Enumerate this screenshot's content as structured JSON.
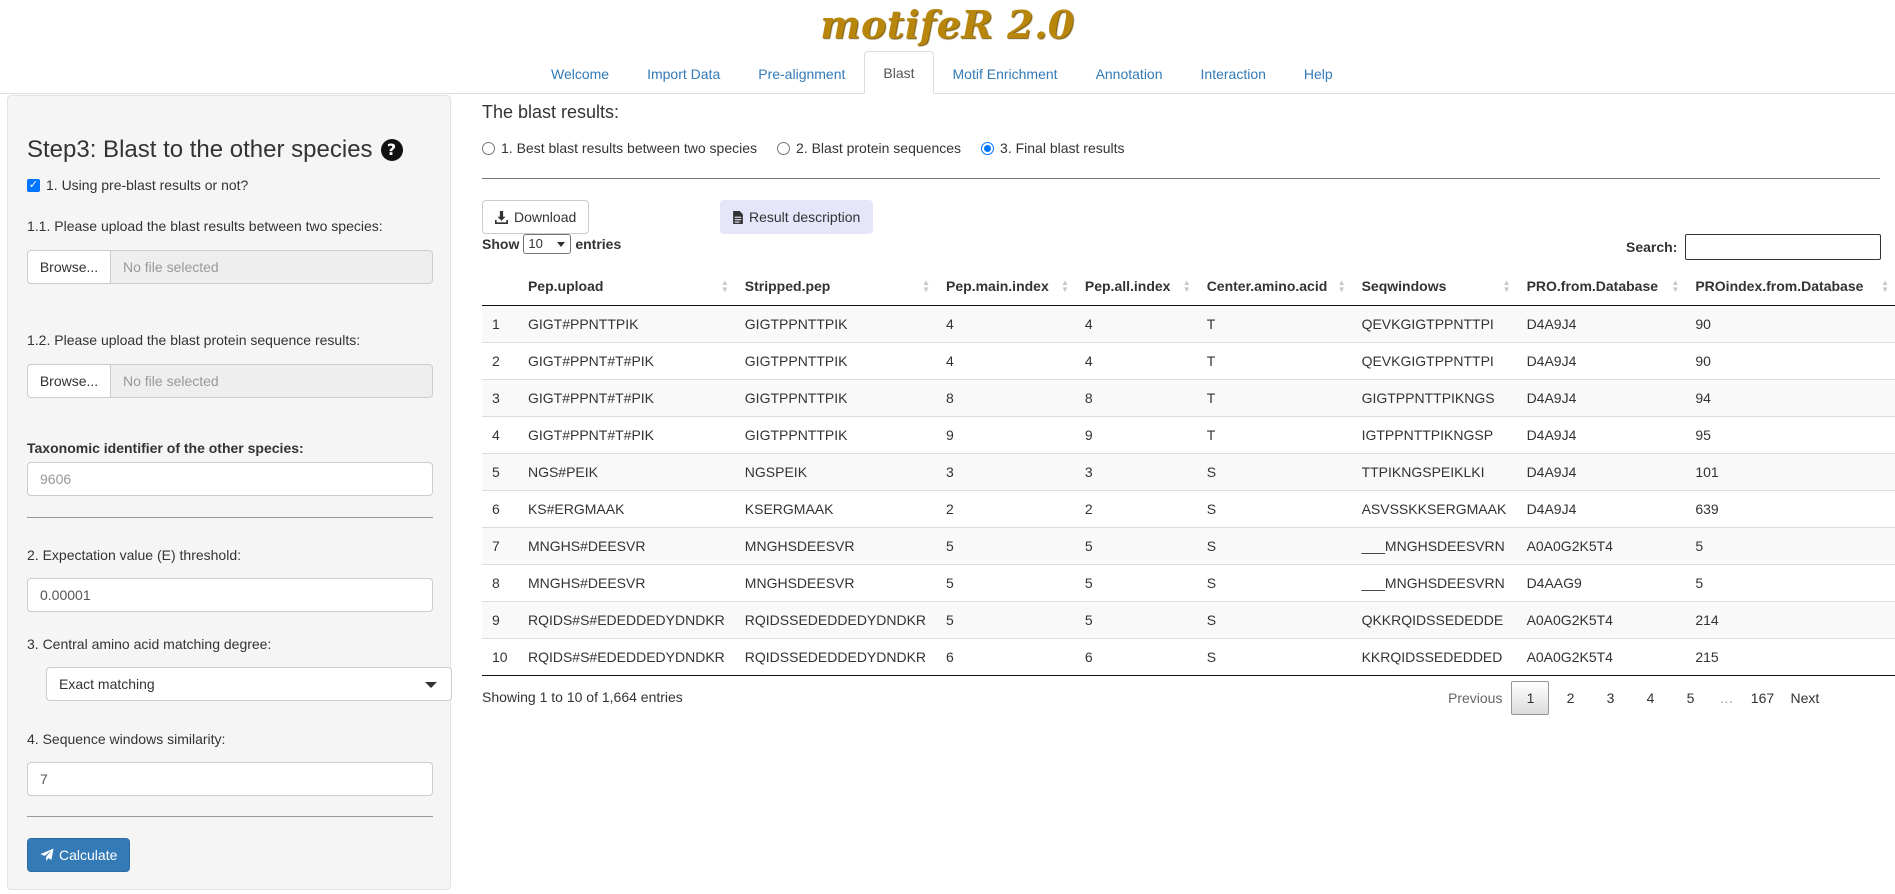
{
  "app": {
    "logo": "motifeR 2.0"
  },
  "nav": {
    "tabs": [
      {
        "label": "Welcome",
        "active": false
      },
      {
        "label": "Import Data",
        "active": false
      },
      {
        "label": "Pre-alignment",
        "active": false
      },
      {
        "label": "Blast",
        "active": true
      },
      {
        "label": "Motif Enrichment",
        "active": false
      },
      {
        "label": "Annotation",
        "active": false
      },
      {
        "label": "Interaction",
        "active": false
      },
      {
        "label": "Help",
        "active": false
      }
    ]
  },
  "sidebar": {
    "title": "Step3: Blast to the other species",
    "help_icon": "question-circle-icon",
    "pre_blast": {
      "label": "1. Using pre-blast results or not?",
      "checked": true
    },
    "upload1": {
      "label": "1.1. Please upload the blast results between two species:",
      "browse": "Browse...",
      "file_text": "No file selected"
    },
    "upload2": {
      "label": "1.2. Please upload the blast protein sequence results:",
      "browse": "Browse...",
      "file_text": "No file selected"
    },
    "taxid": {
      "label": "Taxonomic identifier of the other species:",
      "placeholder": "9606"
    },
    "evalue": {
      "label": "2. Expectation value (E) threshold:",
      "value": "0.00001"
    },
    "central": {
      "label": "3. Central amino acid matching degree:",
      "value": "Exact matching"
    },
    "seqwin": {
      "label": "4. Sequence windows similarity:",
      "value": "7"
    },
    "calculate": {
      "label": "Calculate",
      "icon": "paper-plane-icon"
    }
  },
  "main": {
    "title": "The blast results:",
    "radios": [
      {
        "label": "1. Best blast results between two species",
        "selected": false
      },
      {
        "label": "2. Blast protein sequences",
        "selected": false
      },
      {
        "label": "3. Final blast results",
        "selected": true
      }
    ],
    "download": {
      "label": "Download",
      "icon": "download-icon"
    },
    "desc": {
      "label": "Result description",
      "icon": "file-icon"
    },
    "show": {
      "prefix": "Show",
      "value": "10",
      "suffix": "entries"
    },
    "search": {
      "label": "Search:"
    },
    "table": {
      "headers": [
        "",
        "Pep.upload",
        "Stripped.pep",
        "Pep.main.index",
        "Pep.all.index",
        "Center.amino.acid",
        "Seqwindows",
        "PRO.from.Database",
        "PROindex.from.Database"
      ],
      "rows": [
        [
          "1",
          "GIGT#PPNTTPIK",
          "GIGTPPNTTPIK",
          "4",
          "4",
          "T",
          "QEVKGIGTPPNTTPI",
          "D4A9J4",
          "90"
        ],
        [
          "2",
          "GIGT#PPNT#T#PIK",
          "GIGTPPNTTPIK",
          "4",
          "4",
          "T",
          "QEVKGIGTPPNTTPI",
          "D4A9J4",
          "90"
        ],
        [
          "3",
          "GIGT#PPNT#T#PIK",
          "GIGTPPNTTPIK",
          "8",
          "8",
          "T",
          "GIGTPPNTTPIKNGS",
          "D4A9J4",
          "94"
        ],
        [
          "4",
          "GIGT#PPNT#T#PIK",
          "GIGTPPNTTPIK",
          "9",
          "9",
          "T",
          "IGTPPNTTPIKNGSP",
          "D4A9J4",
          "95"
        ],
        [
          "5",
          "NGS#PEIK",
          "NGSPEIK",
          "3",
          "3",
          "S",
          "TTPIKNGSPEIKLKI",
          "D4A9J4",
          "101"
        ],
        [
          "6",
          "KS#ERGMAAK",
          "KSERGMAAK",
          "2",
          "2",
          "S",
          "ASVSSKKSERGMAAK",
          "D4A9J4",
          "639"
        ],
        [
          "7",
          "MNGHS#DEESVR",
          "MNGHSDEESVR",
          "5",
          "5",
          "S",
          "___MNGHSDEESVRN",
          "A0A0G2K5T4",
          "5"
        ],
        [
          "8",
          "MNGHS#DEESVR",
          "MNGHSDEESVR",
          "5",
          "5",
          "S",
          "___MNGHSDEESVRN",
          "D4AAG9",
          "5"
        ],
        [
          "9",
          "RQIDS#S#EDEDDEDYDNDKR",
          "RQIDSSEDEDDEDYDNDKR",
          "5",
          "5",
          "S",
          "QKKRQIDSSEDEDDE",
          "A0A0G2K5T4",
          "214"
        ],
        [
          "10",
          "RQIDS#S#EDEDDEDYDNDKR",
          "RQIDSSEDEDDEDYDNDKR",
          "6",
          "6",
          "S",
          "KKRQIDSSEDEDDED",
          "A0A0G2K5T4",
          "215"
        ]
      ]
    },
    "info": "Showing 1 to 10 of 1,664 entries",
    "pager": {
      "previous": "Previous",
      "pages": [
        "1",
        "2",
        "3",
        "4",
        "5",
        "…",
        "167"
      ],
      "current": "1",
      "next": "Next"
    }
  }
}
